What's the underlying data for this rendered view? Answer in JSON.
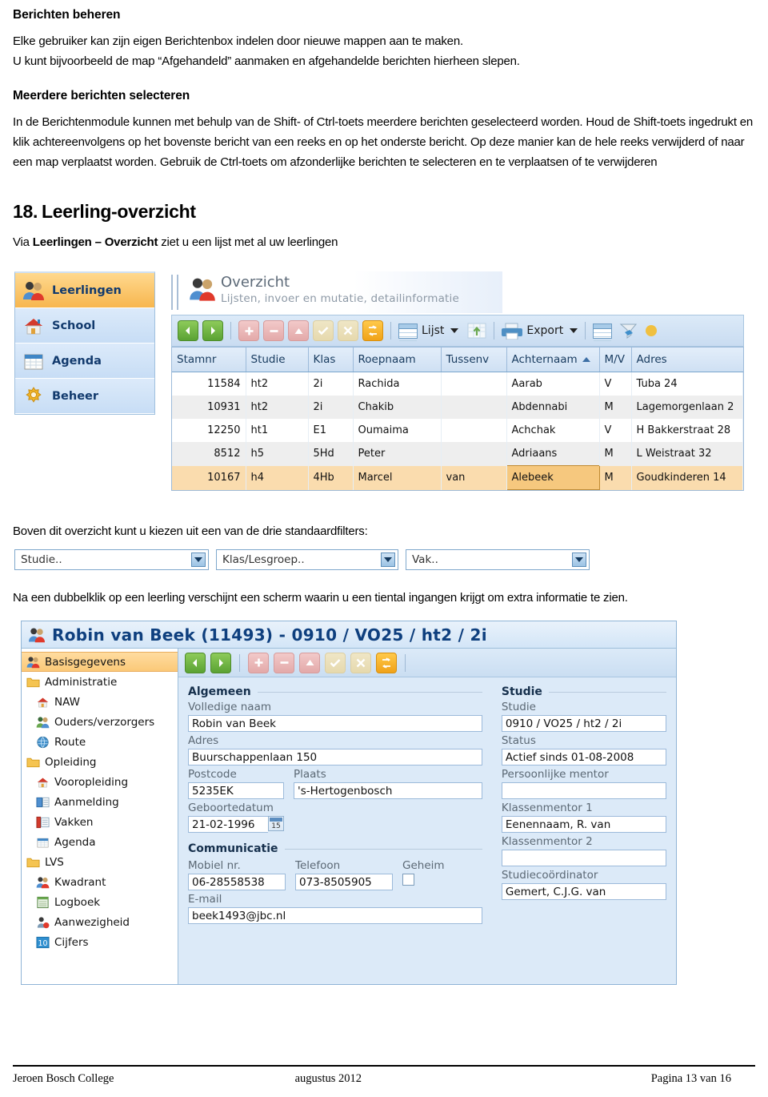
{
  "doc": {
    "heading1": "Berichten beheren",
    "para1_line1": "Elke gebruiker kan zijn eigen Berichtenbox indelen door nieuwe mappen aan te maken.",
    "para1_line2": "U kunt bijvoorbeeld de map “Afgehandeld” aanmaken en afgehandelde berichten hierheen slepen.",
    "heading2": "Meerdere berichten selecteren",
    "para2": "In de Berichtenmodule kunnen met behulp van de Shift- of Ctrl-toets meerdere berichten geselecteerd worden. Houd de Shift-toets ingedrukt en klik achtereenvolgens op het bovenste bericht van een reeks en op het onderste bericht. Op deze manier kan de hele reeks verwijderd of naar een map verplaatst worden. Gebruik de Ctrl-toets om afzonderlijke berichten te selecteren en te verplaatsen of te verwijderen",
    "section_number": "18.",
    "section_title": "Leerling-overzicht",
    "intro_pre": "Via ",
    "intro_bold": "Leerlingen – Overzicht",
    "intro_post": " ziet u een lijst met al uw leerlingen",
    "filters_caption": "Boven dit overzicht kunt u kiezen uit een van de drie standaardfilters:",
    "detail_caption": "Na een dubbelklik op een leerling verschijnt een scherm waarin u een tiental ingangen krijgt om extra informatie te zien."
  },
  "overview": {
    "nav": [
      {
        "label": "Leerlingen",
        "icon": "people-icon",
        "active": true
      },
      {
        "label": "School",
        "icon": "house-icon",
        "active": false
      },
      {
        "label": "Agenda",
        "icon": "calendar-icon",
        "active": false
      },
      {
        "label": "Beheer",
        "icon": "gear-icon",
        "active": false
      }
    ],
    "header": {
      "title": "Overzicht",
      "subtitle": "Lijsten, invoer en mutatie, detailinformatie",
      "icon": "people-icon"
    },
    "toolbar": {
      "prev": "prev-arrow-icon",
      "next": "next-arrow-icon",
      "add": "plus-icon",
      "remove": "minus-icon",
      "up": "up-arrow-icon",
      "confirm": "check-icon",
      "cancel": "cross-icon",
      "refresh": "refresh-icon",
      "list_label": "Lijst",
      "list_icon": "grid-icon",
      "import_icon": "import-icon",
      "print_icon": "printer-icon",
      "export_label": "Export",
      "columns_icon": "columns-icon",
      "filter_icon": "funnel-icon"
    },
    "grid": {
      "columns": [
        "Stamnr",
        "Studie",
        "Klas",
        "Roepnaam",
        "Tussenv",
        "Achternaam",
        "M/V",
        "Adres"
      ],
      "sorted_column": "Achternaam",
      "sort_direction": "asc",
      "rows": [
        {
          "stamnr": "11584",
          "studie": "ht2",
          "klas": "2i",
          "roepnaam": "Rachida",
          "tussenv": "",
          "achternaam": "Aarab",
          "mv": "V",
          "adres": "Tuba 24"
        },
        {
          "stamnr": "10931",
          "studie": "ht2",
          "klas": "2i",
          "roepnaam": "Chakib",
          "tussenv": "",
          "achternaam": "Abdennabi",
          "mv": "M",
          "adres": "Lagemorgenlaan 2"
        },
        {
          "stamnr": "12250",
          "studie": "ht1",
          "klas": "E1",
          "roepnaam": "Oumaima",
          "tussenv": "",
          "achternaam": "Achchak",
          "mv": "V",
          "adres": "H Bakkerstraat 28"
        },
        {
          "stamnr": "8512",
          "studie": "h5",
          "klas": "5Hd",
          "roepnaam": "Peter",
          "tussenv": "",
          "achternaam": "Adriaans",
          "mv": "M",
          "adres": "L Weistraat 32"
        },
        {
          "stamnr": "10167",
          "studie": "h4",
          "klas": "4Hb",
          "roepnaam": "Marcel",
          "tussenv": "van",
          "achternaam": "Alebeek",
          "mv": "M",
          "adres": "Goudkinderen 14"
        }
      ],
      "selected_row_index": 4,
      "selected_cell_column": "Achternaam"
    }
  },
  "filters": [
    {
      "value": "Studie..",
      "name": "studie-filter"
    },
    {
      "value": "Klas/Lesgroep..",
      "name": "klas-lesgroep-filter"
    },
    {
      "value": "Vak..",
      "name": "vak-filter"
    }
  ],
  "detail": {
    "title": "Robin van Beek (11493) - 0910 / VO25 / ht2 / 2i",
    "title_icon": "people-icon",
    "tree": [
      {
        "label": "Basisgegevens",
        "icon": "people-icon",
        "indent": 0,
        "selected": true
      },
      {
        "label": "Administratie",
        "icon": "folder-icon",
        "indent": 0,
        "selected": false
      },
      {
        "label": "NAW",
        "icon": "house-icon",
        "indent": 1,
        "selected": false
      },
      {
        "label": "Ouders/verzorgers",
        "icon": "people-icon",
        "indent": 1,
        "selected": false
      },
      {
        "label": "Route",
        "icon": "globe-icon",
        "indent": 1,
        "selected": false
      },
      {
        "label": "Opleiding",
        "icon": "folder-icon",
        "indent": 0,
        "selected": false
      },
      {
        "label": "Vooropleiding",
        "icon": "house-icon",
        "indent": 1,
        "selected": false
      },
      {
        "label": "Aanmelding",
        "icon": "form-icon",
        "indent": 1,
        "selected": false
      },
      {
        "label": "Vakken",
        "icon": "book-icon",
        "indent": 1,
        "selected": false
      },
      {
        "label": "Agenda",
        "icon": "calendar-icon",
        "indent": 1,
        "selected": false
      },
      {
        "label": "LVS",
        "icon": "folder-icon",
        "indent": 0,
        "selected": false
      },
      {
        "label": "Kwadrant",
        "icon": "people-icon",
        "indent": 1,
        "selected": false
      },
      {
        "label": "Logboek",
        "icon": "notebook-icon",
        "indent": 1,
        "selected": false
      },
      {
        "label": "Aanwezigheid",
        "icon": "person-red-icon",
        "indent": 1,
        "selected": false
      },
      {
        "label": "Cijfers",
        "icon": "grade-10-icon",
        "indent": 1,
        "selected": false
      }
    ],
    "tree_badge": "10",
    "toolbar": {
      "prev": "prev-arrow-icon",
      "next": "next-arrow-icon",
      "add": "plus-icon",
      "remove": "minus-icon",
      "up": "up-arrow-icon",
      "confirm": "check-icon",
      "cancel": "cross-icon",
      "refresh": "refresh-icon"
    },
    "groups": {
      "algemeen": "Algemeen",
      "communicatie": "Communicatie",
      "studie": "Studie"
    },
    "fields": {
      "volledige_naam_label": "Volledige naam",
      "volledige_naam_value": "Robin van Beek",
      "adres_label": "Adres",
      "adres_value": "Buurschappenlaan 150",
      "postcode_label": "Postcode",
      "postcode_value": "5235EK",
      "plaats_label": "Plaats",
      "plaats_value": "'s-Hertogenbosch",
      "geboortedatum_label": "Geboortedatum",
      "geboortedatum_value": "21-02-1996",
      "calendar_day": "15",
      "mobiel_label": "Mobiel nr.",
      "mobiel_value": "06-28558538",
      "telefoon_label": "Telefoon",
      "telefoon_value": "073-8505905",
      "geheim_label": "Geheim",
      "geheim_checked": false,
      "email_label": "E-mail",
      "email_value": "beek1493@jbc.nl",
      "studie_label": "Studie",
      "studie_value": "0910 / VO25 / ht2 / 2i",
      "status_label": "Status",
      "status_value": "Actief sinds 01-08-2008",
      "persoonlijke_mentor_label": "Persoonlijke mentor",
      "persoonlijke_mentor_value": "",
      "klassenmentor1_label": "Klassenmentor 1",
      "klassenmentor1_value": "Eenennaam, R. van",
      "klassenmentor2_label": "Klassenmentor 2",
      "klassenmentor2_value": "",
      "studiecoordinator_label": "Studiecoördinator",
      "studiecoordinator_value": "Gemert, C.J.G. van"
    }
  },
  "footer": {
    "left": "Jeroen Bosch College",
    "center": "augustus 2012",
    "right": "Pagina 13 van 16"
  },
  "colors": {
    "accent_blue": "#0e3f7e",
    "selection_orange": "#fbc978",
    "grid_header": "#cfe0f3",
    "panel_blue": "#dceaf8"
  }
}
